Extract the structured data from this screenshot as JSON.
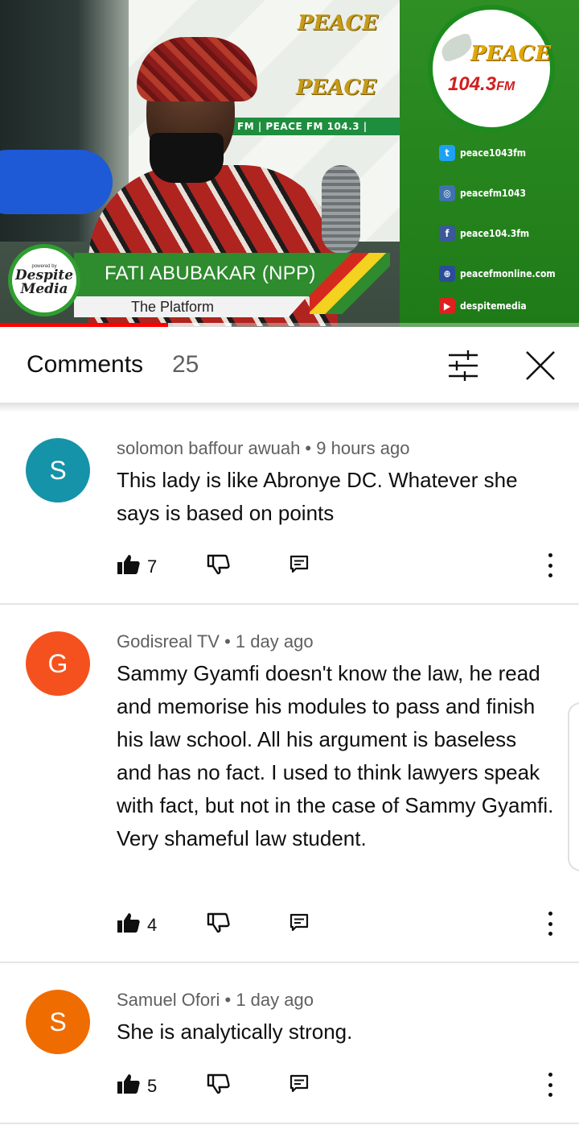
{
  "video": {
    "channel_logo": {
      "name": "PEACE",
      "frequency": "104.3",
      "unit": "FM"
    },
    "studio_banner": "FM  |  PEACE FM 104.3  |",
    "social_handles": [
      {
        "icon": "twitter-icon",
        "text": "peace1043fm",
        "color": "#1da1f2",
        "glyph": "t"
      },
      {
        "icon": "instagram-icon",
        "text": "peacefm1043",
        "color": "#3f72af",
        "glyph": "◎"
      },
      {
        "icon": "facebook-icon",
        "text": "peace104.3fm",
        "color": "#3b5998",
        "glyph": "f"
      },
      {
        "icon": "web-icon",
        "text": "peacefmonline.com",
        "color": "#2b4c9a",
        "glyph": "⊕"
      },
      {
        "icon": "youtube-icon",
        "text": "despitemedia",
        "color": "#e02020",
        "glyph": "▶"
      }
    ],
    "powered_by": "powered by",
    "sponsor": [
      "Despite",
      "Media"
    ],
    "lower_third_name": "FATI ABUBAKAR (NPP)",
    "lower_third_show": "The Platform",
    "progress_fraction": 0.29,
    "buffer_fraction": 0.4
  },
  "comments_panel": {
    "title": "Comments",
    "count": "25",
    "icons": {
      "filter": "filter-sliders-icon",
      "close": "close-icon"
    }
  },
  "comments": [
    {
      "avatar_letter": "S",
      "avatar_color": "#1593a8",
      "author": "solomon baffour awuah",
      "time": "9 hours ago",
      "text": "This lady is like Abronye DC. Whatever  she says is based on points",
      "likes": "7"
    },
    {
      "avatar_letter": "G",
      "avatar_color": "#f4511e",
      "author": "Godisreal TV",
      "time": "1 day ago",
      "text": "Sammy Gyamfi doesn't know the law, he read and memorise his modules to pass and finish his law school. All his argument is baseless and has no fact. I used to think lawyers speak with fact, but not in the case of Sammy Gyamfi. Very shameful law student.",
      "likes": "4"
    },
    {
      "avatar_letter": "S",
      "avatar_color": "#ef6c00",
      "author": "Samuel Ofori",
      "time": "1 day ago",
      "text": "She is analytically  strong.",
      "likes": "5"
    }
  ],
  "separator": " • "
}
